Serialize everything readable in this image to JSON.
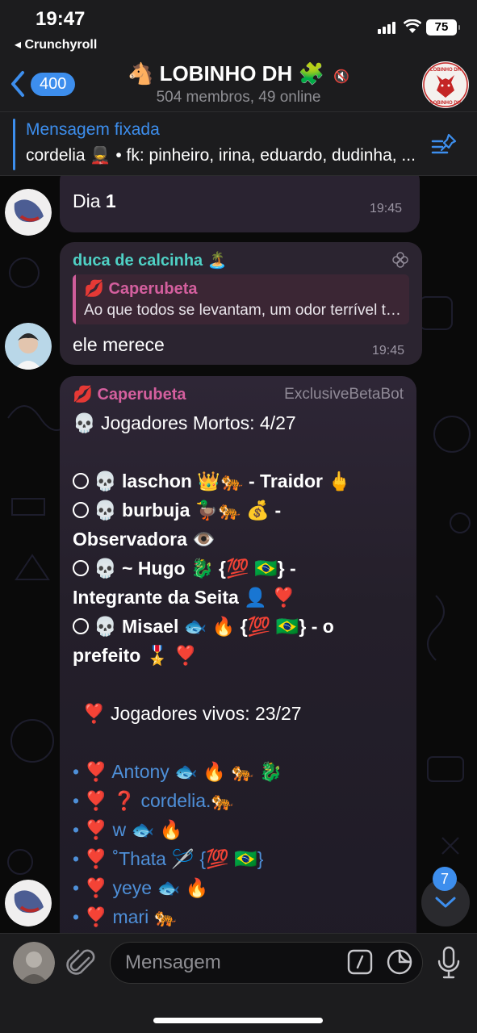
{
  "status_bar": {
    "time": "19:47",
    "back_app": "◂ Crunchyroll",
    "battery": "75"
  },
  "header": {
    "back_count": "400",
    "title": "🐴 LOBINHO DH 🧩",
    "mute_icon": "🔇",
    "subtitle": "504 membros, 49 online",
    "avatar_icon": "wolf-logo-icon",
    "avatar_text_top": "LOBINHO DH",
    "avatar_text_bottom": "LOBINHO DH"
  },
  "pinned": {
    "title": "Mensagem fixada",
    "text": "cordelia 💂 • fk: pinheiro, irina, eduardo, dudinha, ..."
  },
  "messages": [
    {
      "text_prefix": "Dia ",
      "text_bold": "1",
      "time": "19:45"
    },
    {
      "sender": "duca de calcinha 🏝️",
      "sender_color": "#4fd1c5",
      "reply_name": "💋 Caperubeta",
      "reply_text": "Ao que todos se levantam, um odor terrível toma conta...",
      "text": "ele merece",
      "time": "19:45"
    },
    {
      "sender": "💋 Caperubeta",
      "sender_color": "#d45f9e",
      "bot": "ExclusiveBetaBot",
      "dead_header": "💀 Jogadores Mortos: 4/27",
      "dead": [
        "💀 laschon 👑🐅 - Traidor 🖕",
        "💀 burbuja 🦆🐅 💰 -",
        "Observadora 👁️",
        "💀 ~ Hugo 🐉 {💯 🇧🇷} -",
        "Integrante da Seita 👤 ❣️",
        "💀 Misael 🐟 🔥 {💯 🇧🇷} - o",
        "prefeito 🎖️ ❣️"
      ],
      "alive_header": "❣️ Jogadores vivos: 23/27",
      "alive": [
        "• ❣️ Antony 🐟 🔥 🐅 🐉",
        "• ❣️ ❓ cordelia.🐅",
        "• ❣️    w 🐟 🔥",
        "• ❣️ ˚Thata 🪡 {💯 🇧🇷}",
        "• ❣️ yeye 🐟 🔥",
        "• ❣️ mari 🐅"
      ]
    }
  ],
  "scroll_badge": "7",
  "input": {
    "placeholder": "Mensagem"
  },
  "colors": {
    "accent": "#3d8eed",
    "bubble": "#2b2430",
    "mention": "#4e8fd8"
  }
}
